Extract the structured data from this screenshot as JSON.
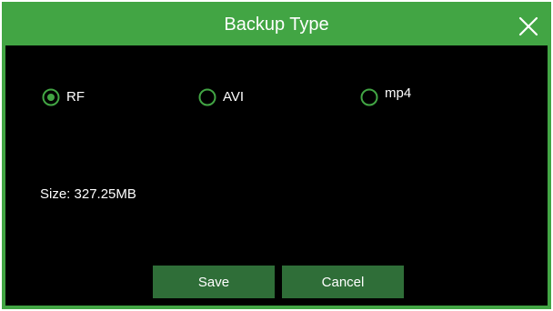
{
  "dialog": {
    "title": "Backup Type",
    "close_icon": "close-icon"
  },
  "backup_types": {
    "selected": "RF",
    "options": [
      {
        "label": "RF",
        "checked": true
      },
      {
        "label": "AVI",
        "checked": false
      },
      {
        "label": "mp4",
        "checked": false
      }
    ]
  },
  "size": {
    "text": "Size: 327.25MB"
  },
  "buttons": {
    "save_label": "Save",
    "cancel_label": "Cancel"
  },
  "colors": {
    "accent": "#42a544",
    "background": "#000000",
    "button": "#2f6e38",
    "text": "#ffffff"
  }
}
